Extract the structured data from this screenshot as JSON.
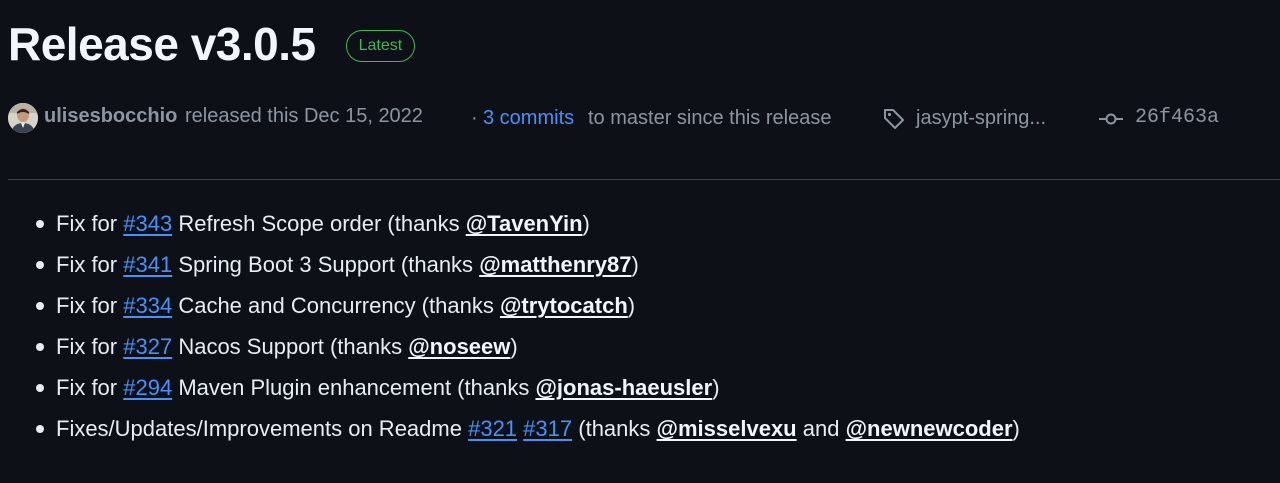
{
  "release": {
    "title": "Release v3.0.5",
    "badge": "Latest"
  },
  "meta": {
    "author": "ulisesbocchio",
    "released_text": "released this Dec 15, 2022",
    "separator": "·",
    "commits_link": "3 commits",
    "commits_text": "to master since this release",
    "tag_label": "jasypt-spring...",
    "commit_sha": "26f463a"
  },
  "notes": [
    {
      "prefix": "Fix for",
      "issue": "#343",
      "text": "Refresh Scope order (thanks",
      "mention": "@TavenYin",
      "suffix": ")"
    },
    {
      "prefix": "Fix for",
      "issue": "#341",
      "text": "Spring Boot 3 Support (thanks",
      "mention": "@matthenry87",
      "suffix": ")"
    },
    {
      "prefix": "Fix for",
      "issue": "#334",
      "text": "Cache and Concurrency (thanks",
      "mention": "@trytocatch",
      "suffix": ")"
    },
    {
      "prefix": "Fix for",
      "issue": "#327",
      "text": "Nacos Support (thanks",
      "mention": "@noseew",
      "suffix": ")"
    },
    {
      "prefix": "Fix for",
      "issue": "#294",
      "text": "Maven Plugin enhancement (thanks",
      "mention": "@jonas-haeusler",
      "suffix": ")"
    },
    {
      "prefix": "Fixes/Updates/Improvements on Readme",
      "issue": "#321",
      "issue2": "#317",
      "text": "(thanks",
      "mention": "@misselvexu",
      "conj": "and",
      "mention2": "@newnewcoder",
      "suffix": ")"
    }
  ],
  "icons": {
    "tag": "tag-icon",
    "commit": "git-commit-icon",
    "avatar": "user-avatar"
  },
  "colors": {
    "background": "#0d1117",
    "link": "#4493f8",
    "badge": "#3fb950",
    "muted": "#8d96a0",
    "text": "#e6edf3",
    "divider": "#3d444d"
  }
}
